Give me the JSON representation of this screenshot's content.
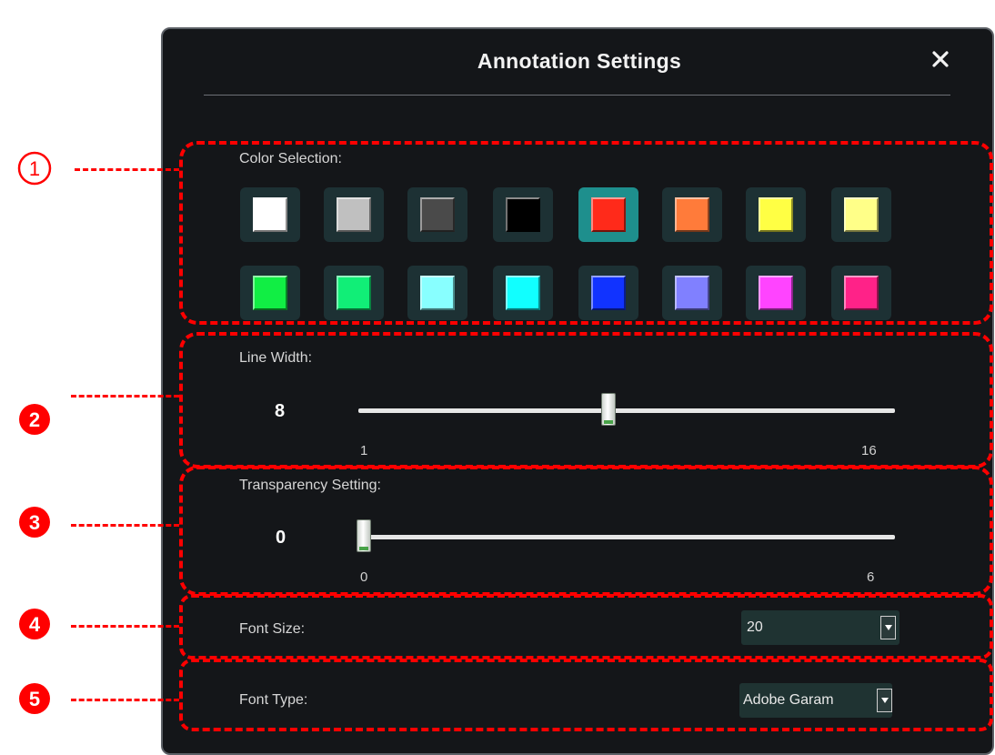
{
  "dialog": {
    "title": "Annotation Settings",
    "close_icon": "close-icon"
  },
  "color_selection": {
    "label": "Color Selection:",
    "selected_index": 4,
    "swatches": [
      {
        "name": "white",
        "hex": "#ffffff"
      },
      {
        "name": "light-gray",
        "hex": "#c0c0c0"
      },
      {
        "name": "dark-gray",
        "hex": "#4a4a4a"
      },
      {
        "name": "black",
        "hex": "#000000"
      },
      {
        "name": "red",
        "hex": "#ff2a1a"
      },
      {
        "name": "orange",
        "hex": "#ff7b3a"
      },
      {
        "name": "yellow",
        "hex": "#ffff44"
      },
      {
        "name": "light-yellow",
        "hex": "#ffff88"
      },
      {
        "name": "green",
        "hex": "#11ee44"
      },
      {
        "name": "sea-green",
        "hex": "#11ee77"
      },
      {
        "name": "light-cyan",
        "hex": "#88ffff"
      },
      {
        "name": "cyan",
        "hex": "#11ffff"
      },
      {
        "name": "blue",
        "hex": "#1133ff"
      },
      {
        "name": "periwinkle",
        "hex": "#8080ff"
      },
      {
        "name": "magenta",
        "hex": "#ff44ff"
      },
      {
        "name": "pink",
        "hex": "#ff2288"
      }
    ]
  },
  "line_width": {
    "label": "Line Width:",
    "value": "8",
    "min": "1",
    "max": "16"
  },
  "transparency": {
    "label": "Transparency Setting:",
    "value": "0",
    "min": "0",
    "max": "6"
  },
  "font_size": {
    "label": "Font Size:",
    "selected": "20"
  },
  "font_type": {
    "label": "Font Type:",
    "selected": "Adobe Garam"
  },
  "callouts": {
    "markers": [
      "①",
      "②",
      "③",
      "④",
      "⑤"
    ],
    "color": "#ff0000"
  }
}
